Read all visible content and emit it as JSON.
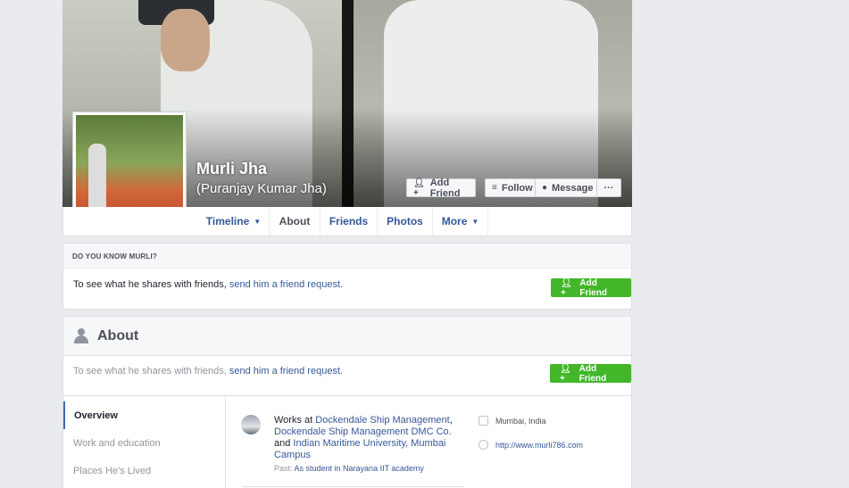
{
  "profile": {
    "name": "Murli Jha",
    "alternate_name": "(Puranjay Kumar Jha)"
  },
  "cover_buttons": {
    "add_friend": "Add Friend",
    "follow": "Follow",
    "message": "Message",
    "more": "···"
  },
  "tabs": [
    {
      "label": "Timeline",
      "dropdown": true
    },
    {
      "label": "About",
      "active": true
    },
    {
      "label": "Friends"
    },
    {
      "label": "Photos"
    },
    {
      "label": "More",
      "dropdown": true
    }
  ],
  "know_card": {
    "header": "DO YOU KNOW MURLI?",
    "text": "To see what he shares with friends, ",
    "link": "send him a friend request.",
    "button": "Add Friend"
  },
  "about": {
    "title": "About",
    "request_text": "To see what he shares with friends, ",
    "request_link": "send him a friend request.",
    "button": "Add Friend",
    "nav": [
      "Overview",
      "Work and education",
      "Places He's Lived"
    ],
    "work": {
      "prefix": "Works at ",
      "employer1": "Dockendale Ship Management",
      "sep1": ", ",
      "employer2": "Dockendale Ship Management DMC Co.",
      "and": " and ",
      "employer3": "Indian Maritime University, Mumbai Campus",
      "past_label": "Past: ",
      "past_value": "As student in Narayana IIT academy"
    },
    "location": "Mumbai, India",
    "website": "http://www.murli786.com"
  },
  "colors": {
    "link": "#365899",
    "green_button": "#42b72a",
    "page_bg": "#e9ebee"
  }
}
